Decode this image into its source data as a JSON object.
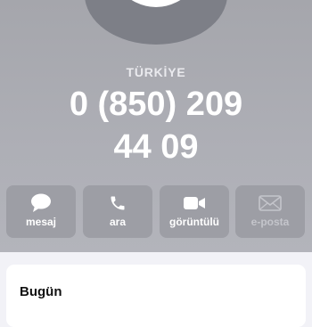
{
  "contact": {
    "country": "TÜRKİYE",
    "phone_line1": "0 (850) 209",
    "phone_line2": "44 09"
  },
  "actions": [
    {
      "label": "mesaj",
      "icon": "message-bubble-icon",
      "enabled": true
    },
    {
      "label": "ara",
      "icon": "phone-icon",
      "enabled": true
    },
    {
      "label": "görüntülü",
      "icon": "video-camera-icon",
      "enabled": true
    },
    {
      "label": "e-posta",
      "icon": "envelope-icon",
      "enabled": false
    }
  ],
  "history": {
    "title": "Bugün"
  },
  "colors": {
    "header_background": "#aeafb6",
    "action_button": "#9d9ea5",
    "disabled_text": "#c4c5cb"
  }
}
